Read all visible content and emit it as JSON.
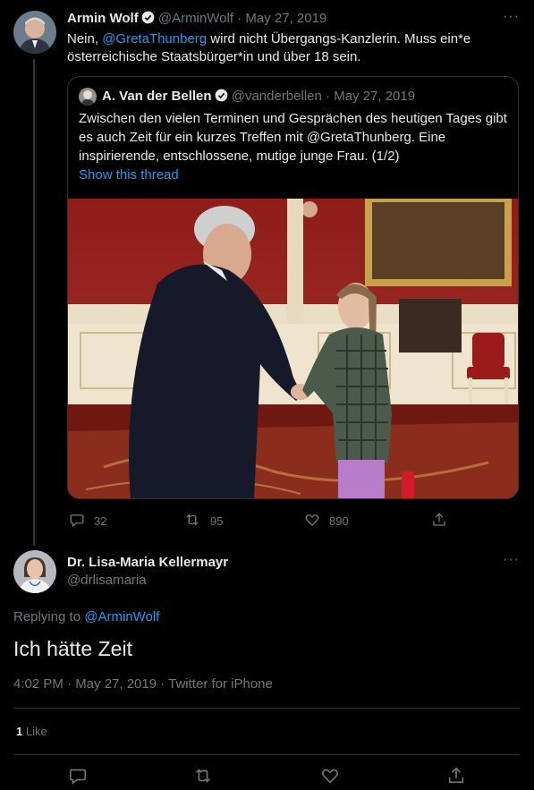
{
  "tweet": {
    "author_name": "Armin Wolf",
    "handle": "@ArminWolf",
    "date": "· May 27, 2019",
    "text_pre": "Nein, ",
    "mention": "@GretaThunberg",
    "text_post": " wird nicht Übergangs-Kanzlerin. Muss ein*e österreichische Staatsbürger*in und über 18 sein.",
    "more": "···"
  },
  "quote": {
    "author_name": "A. Van der Bellen",
    "handle": "@vanderbellen",
    "date": "· May 27, 2019",
    "text": "Zwischen den vielen Terminen und Gesprächen des heutigen Tages gibt es auch Zeit für ein kurzes Treffen mit @GretaThunberg. Eine inspirierende, entschlossene, mutige junge Frau. (1/2)",
    "show_thread": "Show this thread"
  },
  "tweet_actions": {
    "replies": "32",
    "retweets": "95",
    "likes": "890"
  },
  "reply": {
    "author_name": "Dr. Lisa-Maria Kellermayr",
    "handle": "@drlisamaria",
    "replying_to_label": "Replying to ",
    "replying_to_handle": "@ArminWolf",
    "text": "Ich hätte Zeit",
    "timestamp": "4:02 PM · May 27, 2019 · Twitter for iPhone",
    "likes_count": "1",
    "likes_label": "Like",
    "more": "···"
  },
  "colors": {
    "background": "#000000",
    "accent": "#1d9bf0",
    "muted": "#71767b",
    "border": "#2f3336"
  },
  "icons": [
    "verified-icon",
    "reply-icon",
    "retweet-icon",
    "like-icon",
    "share-icon",
    "more-icon"
  ]
}
